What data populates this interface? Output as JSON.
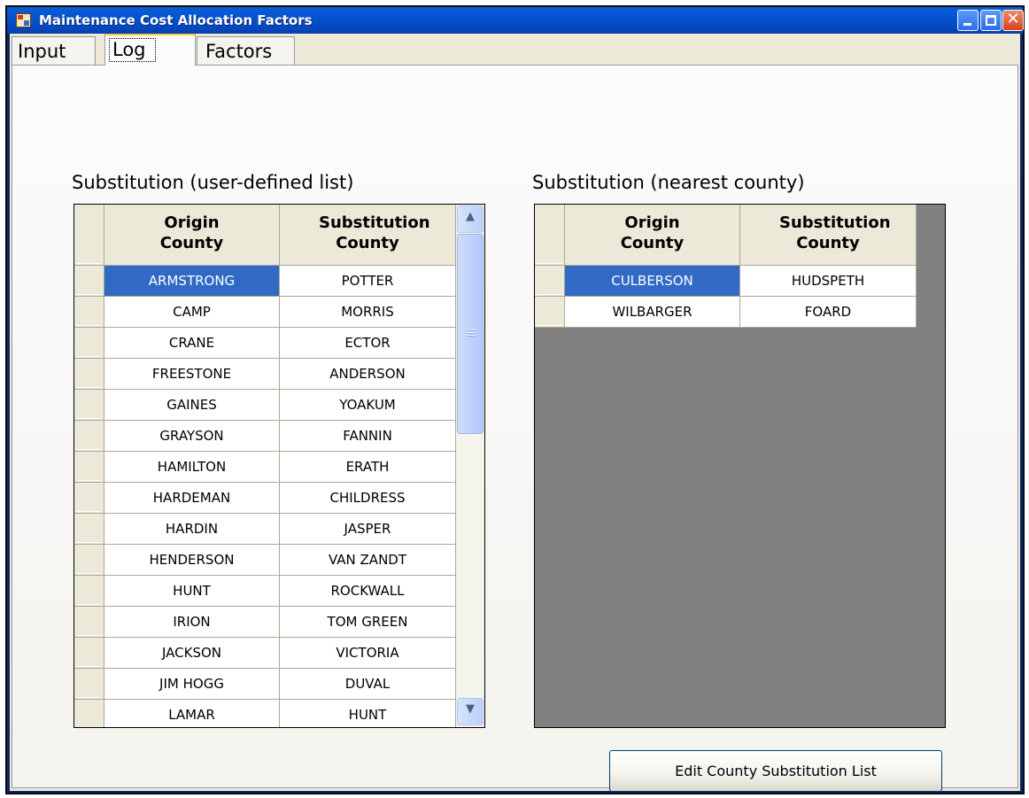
{
  "window": {
    "title": "Maintenance Cost Allocation Factors"
  },
  "tabs": [
    {
      "label": "Input"
    },
    {
      "label": "Log",
      "selected": true
    },
    {
      "label": "Factors"
    }
  ],
  "left_grid": {
    "title": "Substitution (user-defined list)",
    "columns": [
      "Origin\nCounty",
      "Substitution\nCounty"
    ],
    "col1_header": "Origin County",
    "col2_header": "Substitution County",
    "rows": [
      {
        "origin": "ARMSTRONG",
        "substitution": "POTTER",
        "selected": true
      },
      {
        "origin": "CAMP",
        "substitution": "MORRIS"
      },
      {
        "origin": "CRANE",
        "substitution": "ECTOR"
      },
      {
        "origin": "FREESTONE",
        "substitution": "ANDERSON"
      },
      {
        "origin": "GAINES",
        "substitution": "YOAKUM"
      },
      {
        "origin": "GRAYSON",
        "substitution": "FANNIN"
      },
      {
        "origin": "HAMILTON",
        "substitution": "ERATH"
      },
      {
        "origin": "HARDEMAN",
        "substitution": "CHILDRESS"
      },
      {
        "origin": "HARDIN",
        "substitution": "JASPER"
      },
      {
        "origin": "HENDERSON",
        "substitution": "VAN ZANDT"
      },
      {
        "origin": "HUNT",
        "substitution": "ROCKWALL"
      },
      {
        "origin": "IRION",
        "substitution": "TOM GREEN"
      },
      {
        "origin": "JACKSON",
        "substitution": "VICTORIA"
      },
      {
        "origin": "JIM HOGG",
        "substitution": "DUVAL"
      },
      {
        "origin": "LAMAR",
        "substitution": "HUNT"
      }
    ]
  },
  "right_grid": {
    "title": "Substitution (nearest county)",
    "col1_header": "Origin County",
    "col2_header": "Substitution County",
    "rows": [
      {
        "origin": "CULBERSON",
        "substitution": "HUDSPETH",
        "selected": true
      },
      {
        "origin": "WILBARGER",
        "substitution": "FOARD"
      }
    ]
  },
  "edit_button": {
    "label": "Edit County Substitution List"
  },
  "colors": {
    "selection": "#316ac5",
    "titlebar": "#0553d0",
    "empty_grid": "#808080"
  },
  "icons": [
    "app-icon",
    "minimize-icon",
    "maximize-icon",
    "close-icon",
    "scroll-up-icon",
    "scroll-down-icon"
  ]
}
